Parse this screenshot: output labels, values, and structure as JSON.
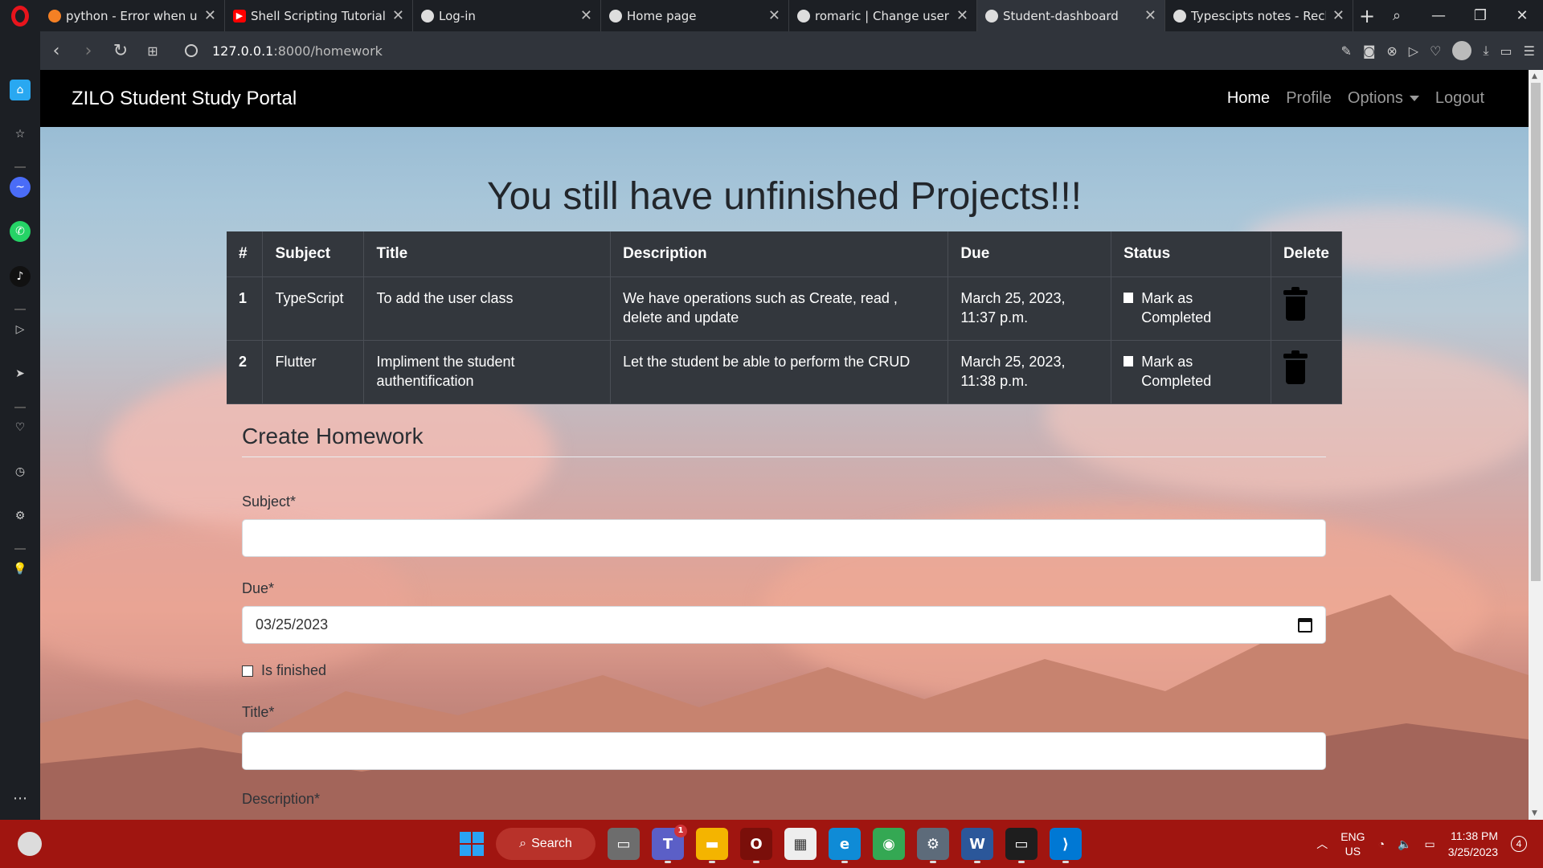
{
  "browser": {
    "tabs": [
      {
        "title": "python - Error when usin",
        "icon": "stackoverflow-icon",
        "active": false
      },
      {
        "title": "Shell Scripting Tutorial | ",
        "icon": "youtube-icon",
        "active": false
      },
      {
        "title": "Log-in",
        "icon": "globe-icon",
        "active": false
      },
      {
        "title": "Home page",
        "icon": "globe-icon",
        "active": false
      },
      {
        "title": "romaric | Change user | D",
        "icon": "globe-icon",
        "active": false
      },
      {
        "title": "Student-dashboard",
        "icon": "globe-icon",
        "active": true
      },
      {
        "title": "Typescipts notes - Reche",
        "icon": "globe-icon",
        "active": false
      }
    ],
    "url_host": "127.0.0.1",
    "url_path": ":8000/homework"
  },
  "navbar": {
    "brand": "ZILO Student Study Portal",
    "links": [
      "Home",
      "Profile",
      "Options",
      "Logout"
    ]
  },
  "page": {
    "heading": "You still have unfinished Projects!!!"
  },
  "table": {
    "headers": [
      "#",
      "Subject",
      "Title",
      "Description",
      "Due",
      "Status",
      "Delete"
    ],
    "rows": [
      {
        "num": "1",
        "subject": "TypeScript",
        "title": "To add the user class",
        "description": "We have operations such as Create, read , delete and update",
        "due": "March 25, 2023, 11:37 p.m.",
        "status": "Mark as Completed"
      },
      {
        "num": "2",
        "subject": "Flutter",
        "title": "Impliment the student authentification",
        "description": "Let the student be able to perform the CRUD",
        "due": "March 25, 2023, 11:38 p.m.",
        "status": "Mark as Completed"
      }
    ]
  },
  "form": {
    "title": "Create Homework",
    "subject_label": "Subject*",
    "due_label": "Due*",
    "due_value": "03/25/2023",
    "finished_label": "Is finished",
    "title_label": "Title*",
    "description_label": "Description*"
  },
  "taskbar": {
    "search_label": "Search",
    "lang_top": "ENG",
    "lang_bottom": "US",
    "time": "11:38 PM",
    "date": "3/25/2023",
    "notifications": "4",
    "teams_badge": "1"
  }
}
